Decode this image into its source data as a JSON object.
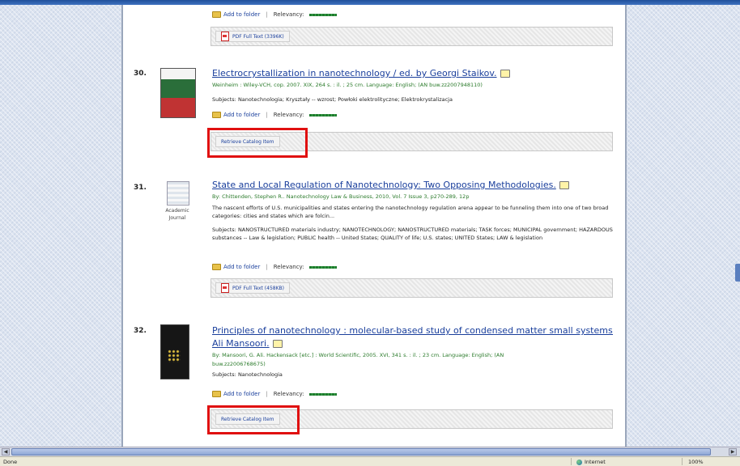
{
  "colors": {
    "link": "#1a3f9c",
    "meta": "#2a7a2a",
    "highlight": "#e01010"
  },
  "item29": {
    "add_to_folder": "Add to folder",
    "relevancy": "Relevancy:",
    "pdf_full_text": "PDF Full Text (3396K)"
  },
  "item30": {
    "number": "30.",
    "title": "Electrocrystallization in nanotechnology / ed. by Georgi Staikov.",
    "meta": "Weinheim : Wiley-VCH, cop. 2007. XIX, 264 s. : il. ; 25 cm. Language: English; (AN buw.zz2007948110)",
    "subjects": "Subjects: Nanotechnologia; Kryształy -- wzrost; Powłoki elektrolityczne; Elektrokrystalizacja",
    "add_to_folder": "Add to folder",
    "relevancy": "Relevancy:",
    "retrieve": "Retrieve Catalog Item"
  },
  "item31": {
    "number": "31.",
    "title": "State and Local Regulation of Nanotechnology: Two Opposing Methodologies.",
    "meta": "By: Chittenden, Stephen R.. Nanotechnology Law & Business, 2010, Vol. 7 Issue 3, p270-289, 12p",
    "desc": "The nascent efforts of U.S. municipalities and states entering the nanotechnology regulation arena appear to be funneling them into one of two broad categories: cities and states which are folcin...",
    "subjects": "Subjects: NANOSTRUCTURED materials industry; NANOTECHNOLOGY; NANOSTRUCTURED materials; TASK forces; MUNICIPAL government; HAZARDOUS substances -- Law & legislation; PUBLIC health -- United States; QUALITY of life; U.S. states; UNITED States; LAW & legislation",
    "type_label": "Academic Journal",
    "add_to_folder": "Add to folder",
    "relevancy": "Relevancy:",
    "pdf_full_text": "PDF Full Text (458KB)"
  },
  "item32": {
    "number": "32.",
    "title_line1": "Principles of nanotechnology : molecular-based study of condensed matter small systems / G.",
    "title_line2": "Ali Mansoori.",
    "meta_line1": "By: Mansoori, G. Ali. Hackensack [etc.] : World Scientific, 2005. XVI, 341 s. : il. ; 23 cm. Language: English; (AN",
    "meta_line2": "buw.zz2006768675)",
    "subjects": "Subjects: Nanotechnologia",
    "add_to_folder": "Add to folder",
    "relevancy": "Relevancy:",
    "retrieve": "Retrieve Catalog Item"
  },
  "statusbar": {
    "left": "Done",
    "zone": "Internet",
    "zoom": "100%"
  }
}
